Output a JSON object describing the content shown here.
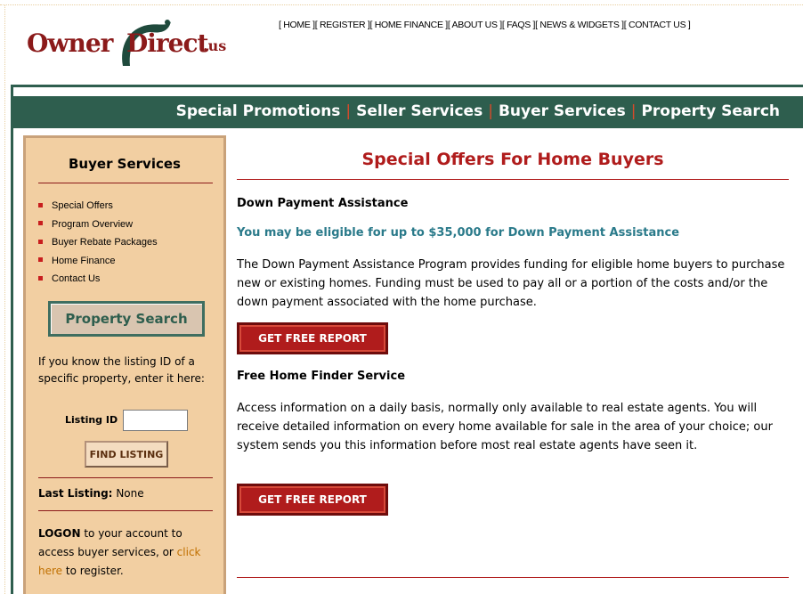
{
  "logo": {
    "owner": "Owner",
    "direct": "Direct",
    "tld": ".us"
  },
  "toplinks": [
    "[ HOME ]",
    "[ REGISTER ]",
    "[ HOME FINANCE ]",
    "[ ABOUT US ]",
    "[ FAQS ]",
    "[ NEWS & WIDGETS ]",
    "[ CONTACT US ]"
  ],
  "nav": {
    "items": [
      "Special Promotions",
      "Seller Services",
      "Buyer Services",
      "Property Search"
    ],
    "separator": "|"
  },
  "sidebar": {
    "title": "Buyer Services",
    "items": [
      "Special Offers",
      "Program Overview",
      "Buyer Rebate Packages",
      "Home Finance",
      "Contact Us"
    ],
    "property_search_label": "Property Search",
    "listing_help": "If you know the listing ID of a specific property, enter it here:",
    "listing_id_label": "Listing ID",
    "listing_id_value": "",
    "find_listing_label": "FIND LISTING",
    "last_listing_label": "Last Listing:",
    "last_listing_value": "None",
    "logon_bold": "LOGON",
    "logon_text_1": " to your account to access buyer services, or ",
    "logon_link": "click here",
    "logon_text_2": " to register."
  },
  "main": {
    "title": "Special Offers For Home Buyers",
    "sections": [
      {
        "heading": "Down Payment Assistance",
        "highlight": "You may be eligible for up to $35,000 for Down Payment Assistance",
        "body": "The Down Payment Assistance Program provides funding for eligible home buyers to purchase new or existing homes. Funding must be used to pay all or a portion of the costs and/or the down payment associated with the home purchase.",
        "button": "GET FREE REPORT"
      },
      {
        "heading": "Free Home Finder Service",
        "body": "Access information on a daily basis, normally only available to real estate agents. You will receive detailed information on every home available for sale in the area of your choice; our system sends you this information before most real estate agents have seen it.",
        "button": "GET FREE REPORT"
      }
    ]
  },
  "colors": {
    "nav_green": "#2e5e4e",
    "brand_red": "#b01c1c",
    "sidebar_tan": "#f2cfa2",
    "teal_text": "#2a7a8a",
    "link_orange": "#c07000"
  }
}
